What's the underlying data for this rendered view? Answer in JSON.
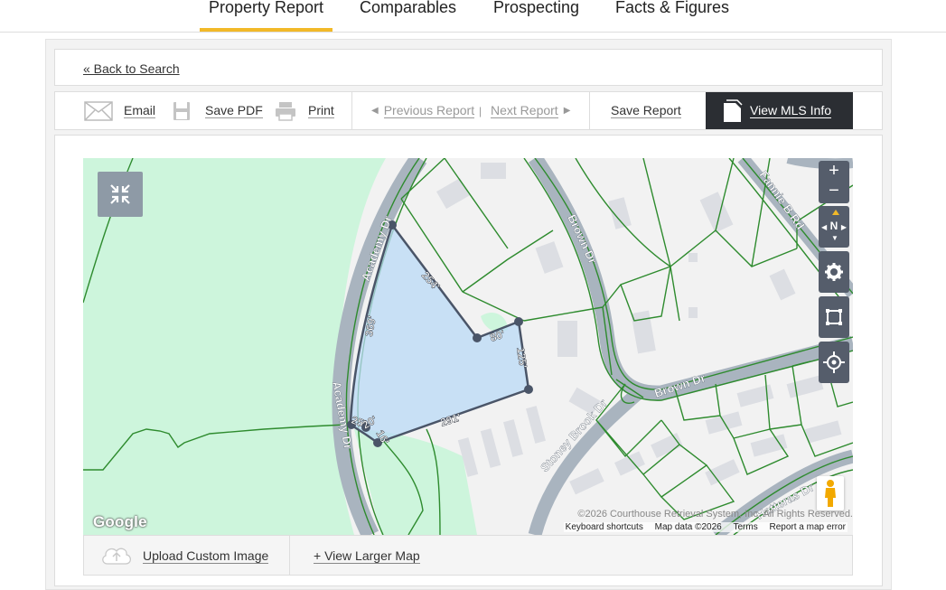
{
  "nav": {
    "tabs": [
      {
        "label": "Property Report",
        "active": true
      },
      {
        "label": "Comparables",
        "active": false
      },
      {
        "label": "Prospecting",
        "active": false
      },
      {
        "label": "Facts & Figures",
        "active": false
      }
    ]
  },
  "back_link": "« Back to Search",
  "toolbar": {
    "email": "Email",
    "save_pdf": "Save PDF",
    "print": "Print",
    "previous_report": "Previous Report",
    "divider": "|",
    "next_report": "Next Report",
    "save_report": "Save Report",
    "view_mls": "View MLS Info"
  },
  "map": {
    "streets": [
      "Academy Dr",
      "Academy Dr",
      "Brown Dr",
      "Brown Dr",
      "Stoney Brook Dr",
      "Fannie B Rd",
      "Hatteras Dr"
    ],
    "dimensions": [
      "254'",
      "369'",
      "80'",
      "125'",
      "291'",
      "25'",
      "20'",
      "16'"
    ],
    "google_logo": "Google",
    "copyright": "©2026 Courthouse Retrieval System, Inc. All Rights Reserved.",
    "attribution": {
      "keyboard": "Keyboard shortcuts",
      "mapdata": "Map data ©2026",
      "terms": "Terms",
      "report": "Report a map error"
    },
    "controls": {
      "zoom_in": "+",
      "zoom_out": "−",
      "compass": "N"
    },
    "colors": {
      "green_area": "#cdf5dc",
      "parcel_fill": "#b9d9f5",
      "parcel_stroke": "#4a5568",
      "parcel_lines": "#2e8b2e",
      "road": "#a9b4bf",
      "control_bg": "#555d6b"
    }
  },
  "bottom": {
    "upload": "Upload Custom Image",
    "view_larger": "+ View Larger Map"
  }
}
